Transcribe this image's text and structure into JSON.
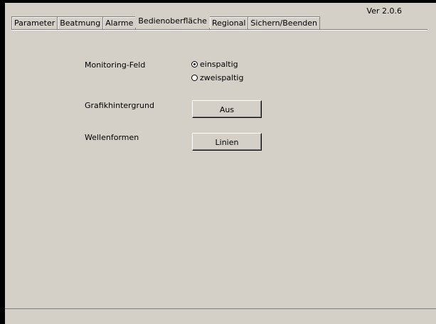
{
  "version": "Ver 2.0.6",
  "tabs": [
    {
      "label": "Parameter"
    },
    {
      "label": "Beatmung"
    },
    {
      "label": "Alarme"
    },
    {
      "label": "Bedienoberfläche",
      "active": true
    },
    {
      "label": "Regional"
    },
    {
      "label": "Sichern/Beenden"
    }
  ],
  "monitoring": {
    "label": "Monitoring-Feld",
    "options": [
      {
        "label": "einspaltig",
        "selected": true
      },
      {
        "label": "zweispaltig",
        "selected": false
      }
    ]
  },
  "graphic_background": {
    "label": "Grafikhintergrund",
    "button_label": "Aus"
  },
  "waveforms": {
    "label": "Wellenformen",
    "button_label": "Linien"
  }
}
